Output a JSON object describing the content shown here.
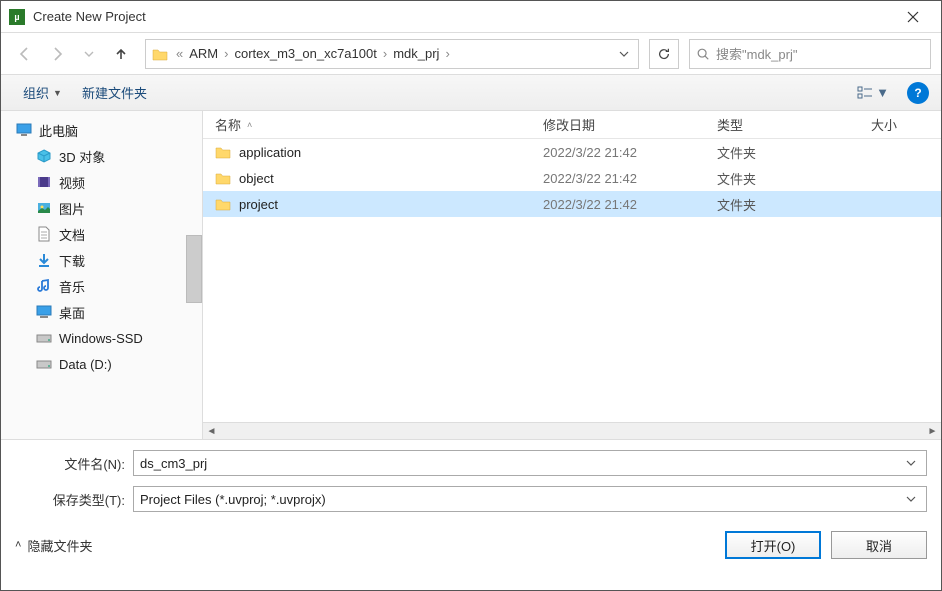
{
  "window": {
    "title": "Create New Project"
  },
  "nav": {
    "breadcrumbs": [
      "ARM",
      "cortex_m3_on_xc7a100t",
      "mdk_prj"
    ],
    "search_placeholder": "搜索\"mdk_prj\""
  },
  "toolbar": {
    "organize": "组织",
    "new_folder": "新建文件夹",
    "help": "?"
  },
  "sidebar": {
    "items": [
      {
        "label": "此电脑",
        "icon": "pc"
      },
      {
        "label": "3D 对象",
        "icon": "3d",
        "child": true
      },
      {
        "label": "视频",
        "icon": "video",
        "child": true
      },
      {
        "label": "图片",
        "icon": "pictures",
        "child": true
      },
      {
        "label": "文档",
        "icon": "documents",
        "child": true
      },
      {
        "label": "下载",
        "icon": "downloads",
        "child": true
      },
      {
        "label": "音乐",
        "icon": "music",
        "child": true
      },
      {
        "label": "桌面",
        "icon": "desktop",
        "child": true
      },
      {
        "label": "Windows-SSD",
        "icon": "drive",
        "child": true
      },
      {
        "label": "Data (D:)",
        "icon": "drive",
        "child": true
      }
    ]
  },
  "columns": {
    "name": "名称",
    "date": "修改日期",
    "type": "类型",
    "size": "大小"
  },
  "files": [
    {
      "name": "application",
      "date": "2022/3/22 21:42",
      "type": "文件夹",
      "selected": false
    },
    {
      "name": "object",
      "date": "2022/3/22 21:42",
      "type": "文件夹",
      "selected": false
    },
    {
      "name": "project",
      "date": "2022/3/22 21:42",
      "type": "文件夹",
      "selected": true
    }
  ],
  "fields": {
    "filename_label": "文件名(N):",
    "filename_value": "ds_cm3_prj",
    "filetype_label": "保存类型(T):",
    "filetype_value": "Project Files (*.uvproj; *.uvprojx)"
  },
  "footer": {
    "hide_folders": "隐藏文件夹",
    "open": "打开(O)",
    "cancel": "取消"
  }
}
